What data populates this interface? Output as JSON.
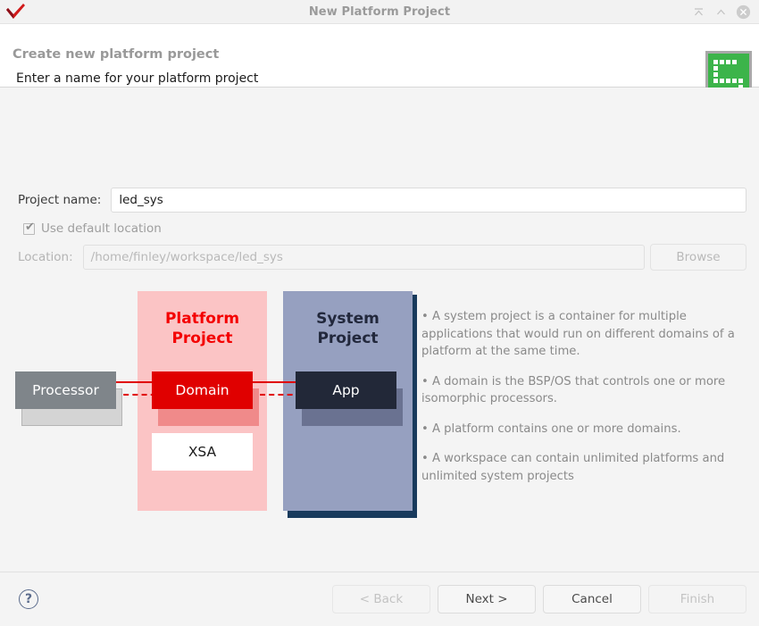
{
  "window": {
    "title": "New Platform Project",
    "logo_icon": "xilinx-check-logo",
    "controls": {
      "minimize_icon": "minimize-icon",
      "maximize_icon": "maximize-icon",
      "close_icon": "close-icon"
    }
  },
  "header": {
    "title": "Create new platform project",
    "subtitle": "Enter a name for your platform project",
    "icon": "platform-project-green-icon"
  },
  "form": {
    "project_name_label": "Project name:",
    "project_name_value": "led_sys",
    "project_name_placeholder": "",
    "use_default_location_label": "Use default location",
    "use_default_location_checked": true,
    "location_label": "Location:",
    "location_value": "/home/finley/workspace/led_sys",
    "browse_label": "Browse"
  },
  "diagram": {
    "platform_panel_title": "Platform\nProject",
    "platform_panel_title_line1": "Platform",
    "platform_panel_title_line2": "Project",
    "system_panel_title_line1": "System",
    "system_panel_title_line2": "Project",
    "processor_label": "Processor",
    "domain_label": "Domain",
    "app_label": "App",
    "xsa_label": "XSA",
    "colors": {
      "platform_panel": "#fbc4c5",
      "platform_title": "#f40000",
      "domain_box": "#e00000",
      "domain_shadow": "#f08a8a",
      "system_panel": "#96a0c0",
      "system_panel_shadow": "#183a5c",
      "system_title": "#22283c",
      "app_box": "#222838",
      "app_shadow": "#6a7291",
      "processor_box": "#7f858a",
      "processor_shadow": "#d4d4d4",
      "xsa_box": "#ffffff",
      "connector_line": "#e00000"
    }
  },
  "bullets": [
    "• A system project is a container for multiple applications that would run on different domains of a platform at the same time.",
    "• A domain is the BSP/OS that controls one or more isomorphic processors.",
    "• A platform contains one or more domains.",
    "• A workspace can contain unlimited platforms and unlimited system projects"
  ],
  "footer": {
    "help_icon": "help-question-icon",
    "buttons": [
      {
        "label": "< Back",
        "enabled": false
      },
      {
        "label": "Next >",
        "enabled": true
      },
      {
        "label": "Cancel",
        "enabled": true
      },
      {
        "label": "Finish",
        "enabled": false
      }
    ]
  }
}
